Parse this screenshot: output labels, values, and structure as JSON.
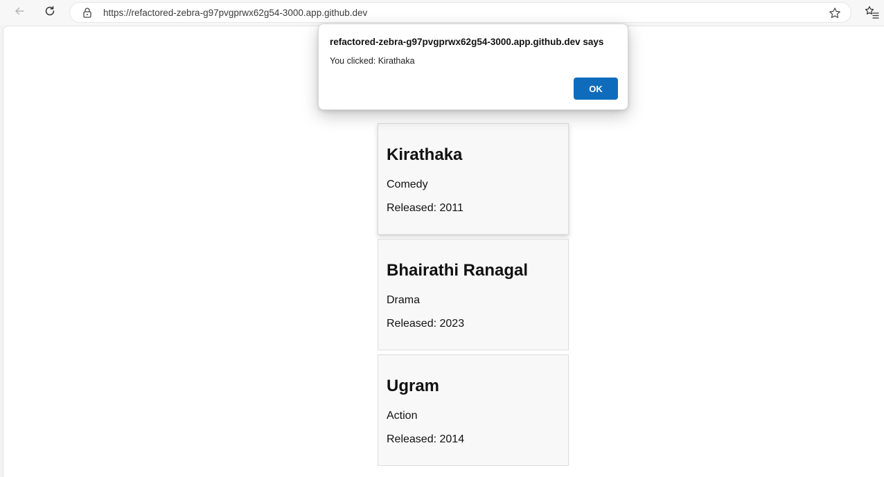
{
  "browser": {
    "url": "https://refactored-zebra-g97pvgprwx62g54-3000.app.github.dev",
    "icons": {
      "back": "back-arrow-icon",
      "reload": "reload-icon",
      "lock": "lock-icon",
      "favorite": "star-icon",
      "favorites_list": "favorites-icon"
    }
  },
  "alert": {
    "title": "refactored-zebra-g97pvgprwx62g54-3000.app.github.dev says",
    "message": "You clicked: Kirathaka",
    "ok_label": "OK",
    "accent_color": "#0f6cbd"
  },
  "movies": [
    {
      "title": "Kirathaka",
      "genre": "Comedy",
      "released": "Released: 2011"
    },
    {
      "title": "Bhairathi Ranagal",
      "genre": "Drama",
      "released": "Released: 2023"
    },
    {
      "title": "Ugram",
      "genre": "Action",
      "released": "Released: 2014"
    }
  ]
}
